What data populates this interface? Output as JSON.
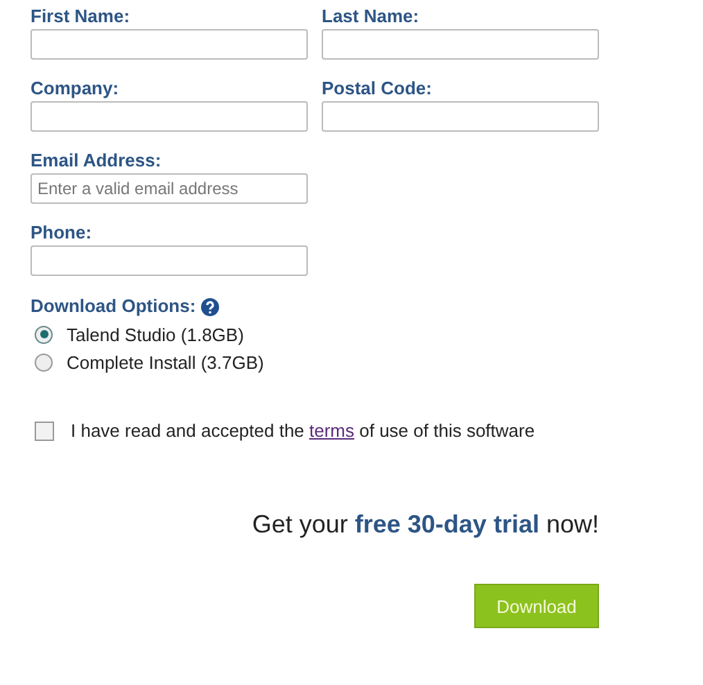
{
  "fields": [
    {
      "label": "First Name:"
    },
    {
      "label": "Last Name:"
    },
    {
      "label": "Company:"
    },
    {
      "label": "Postal Code:"
    },
    {
      "label": "Email Address:",
      "placeholder": "Enter a valid email address"
    },
    {
      "label": "Phone:"
    }
  ],
  "download_options": {
    "label": "Download Options:",
    "options": [
      {
        "label": "Talend Studio (1.8GB)",
        "selected": true
      },
      {
        "label": "Complete Install (3.7GB)",
        "selected": false
      }
    ]
  },
  "terms": {
    "checked": false,
    "before": "I have read and accepted the",
    "link": "terms",
    "after": "of use of this software"
  },
  "promo": "Get your **free 30-day trial** now!",
  "button": "Download"
}
